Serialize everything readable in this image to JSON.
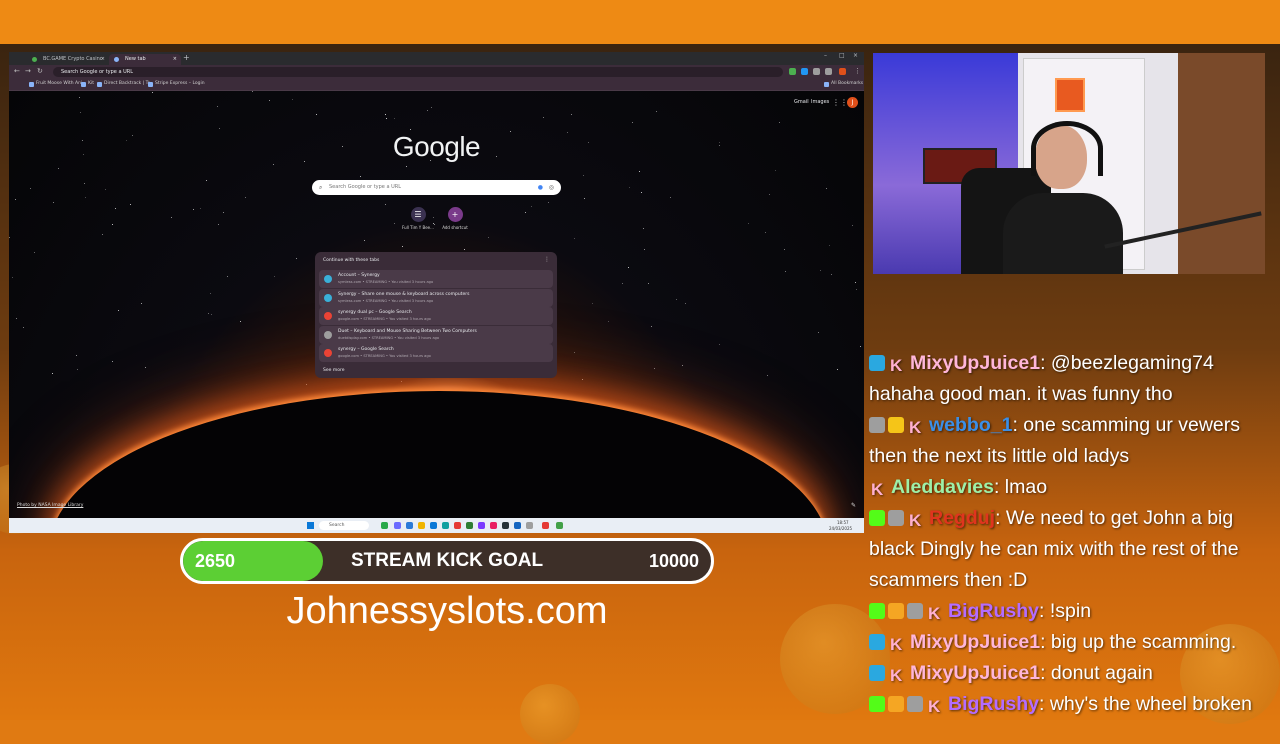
{
  "browser": {
    "tabs": [
      {
        "label": "BC.GAME Crypto Casino Game"
      },
      {
        "label": "New tab"
      }
    ],
    "omnibox_placeholder": "Search Google or type a URL",
    "bookmarks": [
      "Fruit Moose With Ani...",
      "Kit",
      "Direct Backtrack | Tr...",
      "Stripe Express – Login"
    ],
    "all_bookmarks": "All Bookmarks",
    "top_links": {
      "gmail": "Gmail",
      "images": "Images"
    },
    "profile_initial": "J",
    "google_logo": "Google",
    "search_placeholder": "Search Google or type a URL",
    "shortcuts": [
      {
        "label": "Full Tim Y Bee...",
        "glyph": "☰"
      },
      {
        "label": "Add shortcut",
        "glyph": "+"
      }
    ],
    "tabs_card": {
      "header": "Continue with these tabs",
      "rows": [
        {
          "title": "Account – Synergy",
          "meta": "symless.com • STREAMING • You visited 3 hours ago",
          "color": "#3ab0d8"
        },
        {
          "title": "Synergy – Share one mouse & keyboard across computers",
          "meta": "symless.com • STREAMING • You visited 3 hours ago",
          "color": "#3ab0d8"
        },
        {
          "title": "synergy dual pc – Google Search",
          "meta": "google.com • STREAMING • You visited 3 hours ago",
          "color": "#ea4335"
        },
        {
          "title": "Duet – Keyboard and Mouse Sharing Between Two Computers",
          "meta": "duetdisplay.com • STREAMING • You visited 3 hours ago",
          "color": "#9e9e9e"
        },
        {
          "title": "synergy – Google Search",
          "meta": "google.com • STREAMING • You visited 3 hours ago",
          "color": "#ea4335"
        }
      ],
      "see_more": "See more"
    },
    "photo_credit": "Photo by NASA Image Library",
    "taskbar": {
      "search_label": "Search",
      "time": "18:57",
      "date": "24/03/2025"
    }
  },
  "goal": {
    "current": "2650",
    "title": "STREAM KICK GOAL",
    "target": "10000",
    "progress_fraction": 0.265,
    "fill_color": "#5ccf34"
  },
  "site_url": "Johnessyslots.com",
  "chat": [
    {
      "user": "MixyUpJuice1",
      "user_color": "#ffb6d9",
      "badges": [
        "#2aa8e0"
      ],
      "text": ": @beezlegaming74"
    },
    {
      "user": "",
      "user_color": "#ffffff",
      "badges": [],
      "text": "hahaha good man. it was funny tho"
    },
    {
      "user": "webbo_1",
      "user_color": "#3a8fe8",
      "badges": [
        "#9e9e9e",
        "#f5c518"
      ],
      "text": ": one scamming ur vewers"
    },
    {
      "user": "",
      "user_color": "#ffffff",
      "badges": [],
      "text": "then the next its little old ladys"
    },
    {
      "user": "Aleddavies",
      "user_color": "#9ef0a8",
      "badges": [],
      "text": ": lmao"
    },
    {
      "user": "Regduj",
      "user_color": "#e0341e",
      "badges": [
        "#53fc18",
        "#9e9e9e"
      ],
      "text": ": We need to get John a big"
    },
    {
      "user": "",
      "user_color": "#ffffff",
      "badges": [],
      "text": "black Dingly he can mix with the rest of the"
    },
    {
      "user": "",
      "user_color": "#ffffff",
      "badges": [],
      "text": "scammers then :D"
    },
    {
      "user": "BigRushy",
      "user_color": "#b46cff",
      "badges": [
        "#53fc18",
        "#f5a623",
        "#9e9e9e"
      ],
      "text": ": !spin"
    },
    {
      "user": "MixyUpJuice1",
      "user_color": "#ffb6d9",
      "badges": [
        "#2aa8e0"
      ],
      "text": ": big up the scamming."
    },
    {
      "user": "MixyUpJuice1",
      "user_color": "#ffb6d9",
      "badges": [
        "#2aa8e0"
      ],
      "text": ": donut again"
    },
    {
      "user": "BigRushy",
      "user_color": "#b46cff",
      "badges": [
        "#53fc18",
        "#f5a623",
        "#9e9e9e"
      ],
      "text": ": why's the wheel broken"
    }
  ]
}
